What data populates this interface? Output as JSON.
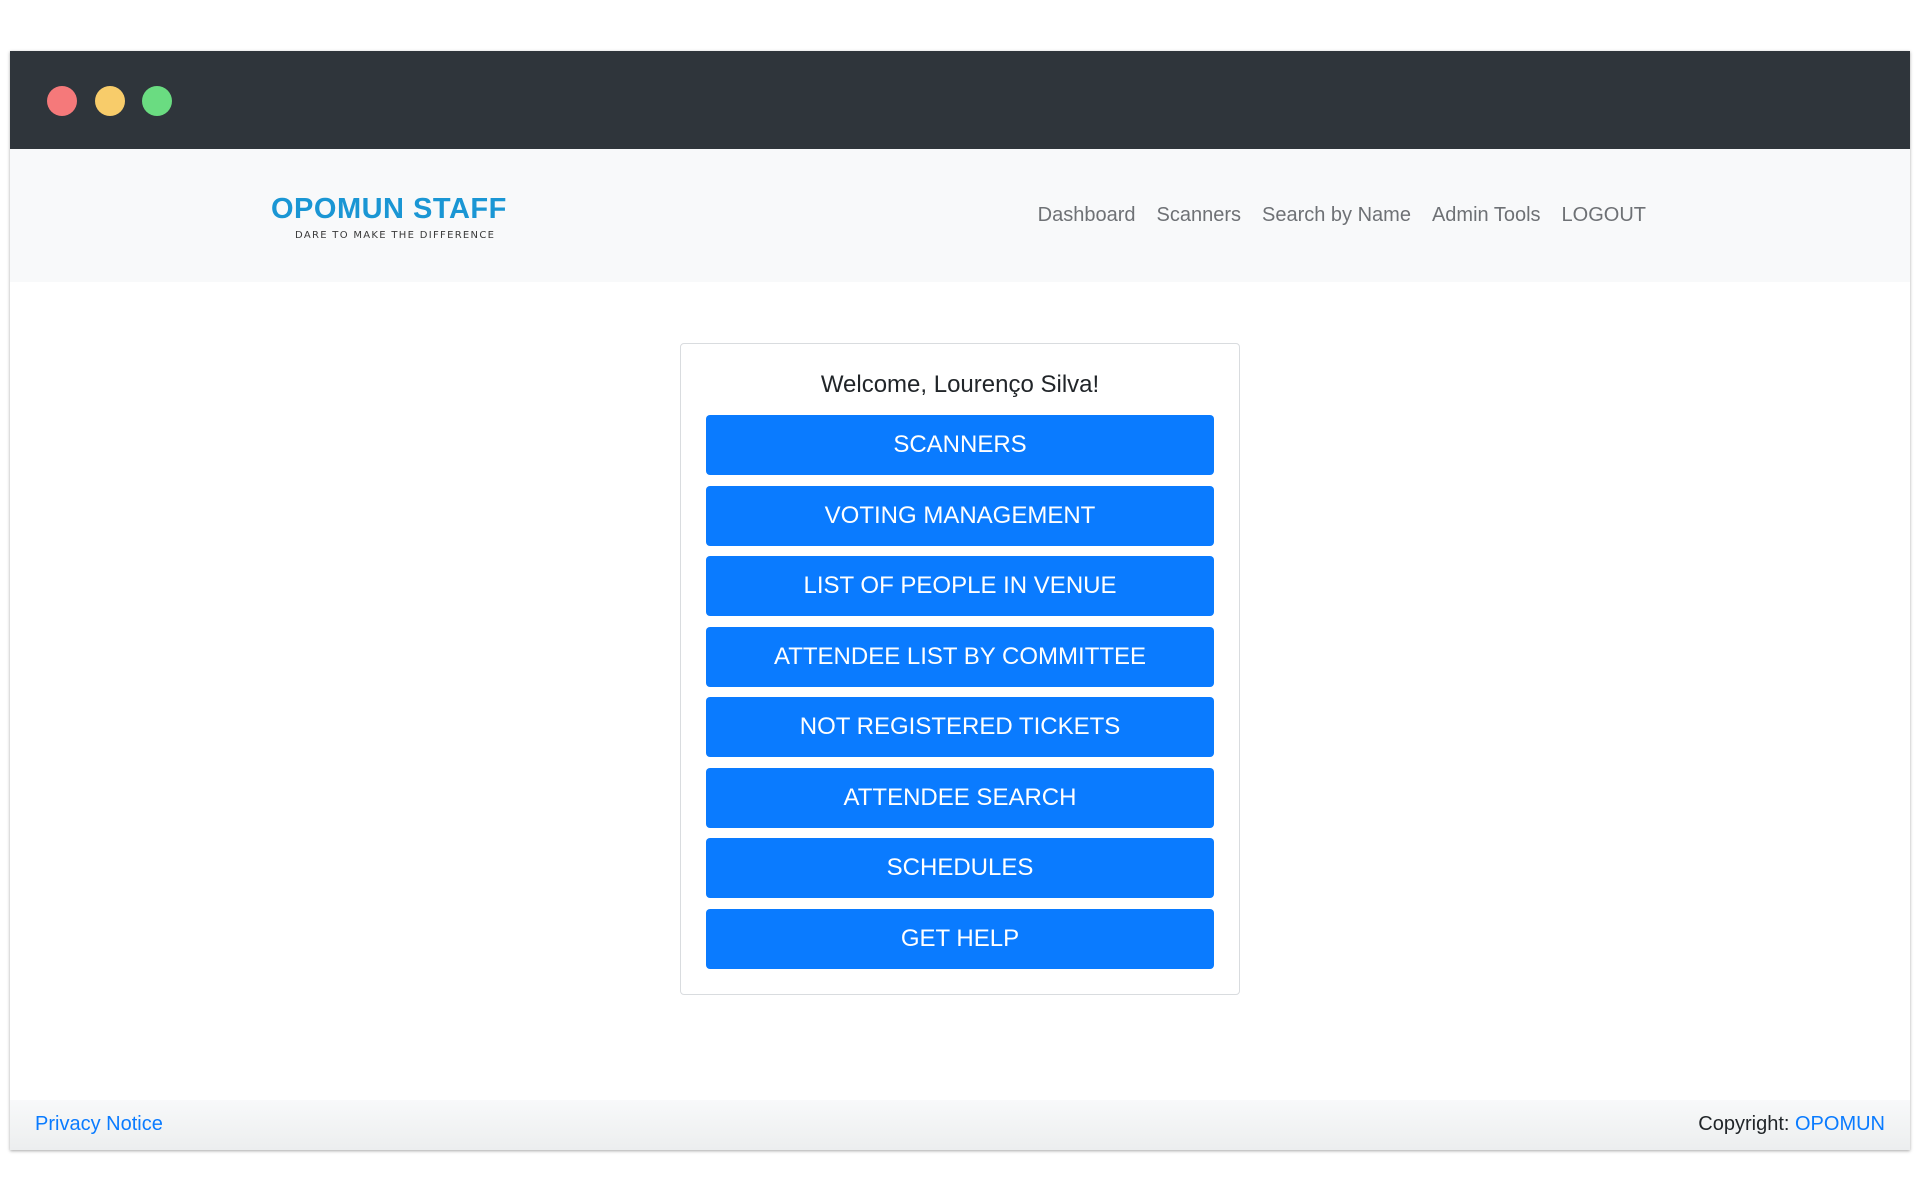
{
  "window": {
    "controls": [
      "close",
      "minimize",
      "maximize"
    ],
    "colors": {
      "close": "#f5797a",
      "minimize": "#f8cc6a",
      "maximize": "#6adc81",
      "titlebar": "#2f353b"
    }
  },
  "header": {
    "brand_title": "OPOMUN STAFF",
    "brand_tagline": "DARE TO MAKE THE DIFFERENCE",
    "nav": [
      "Dashboard",
      "Scanners",
      "Search by Name",
      "Admin Tools",
      "LOGOUT"
    ]
  },
  "main": {
    "welcome": "Welcome, Lourenço Silva!",
    "buttons": [
      "SCANNERS",
      "VOTING MANAGEMENT",
      "LIST OF PEOPLE IN VENUE",
      "ATTENDEE LIST BY COMMITTEE",
      "NOT REGISTERED TICKETS",
      "ATTENDEE SEARCH",
      "SCHEDULES",
      "GET HELP"
    ]
  },
  "footer": {
    "privacy": "Privacy Notice",
    "copyright_label": "Copyright: ",
    "copyright_link": "OPOMUN"
  },
  "colors": {
    "accent": "#0a7bff",
    "brand": "#1a96d4"
  }
}
